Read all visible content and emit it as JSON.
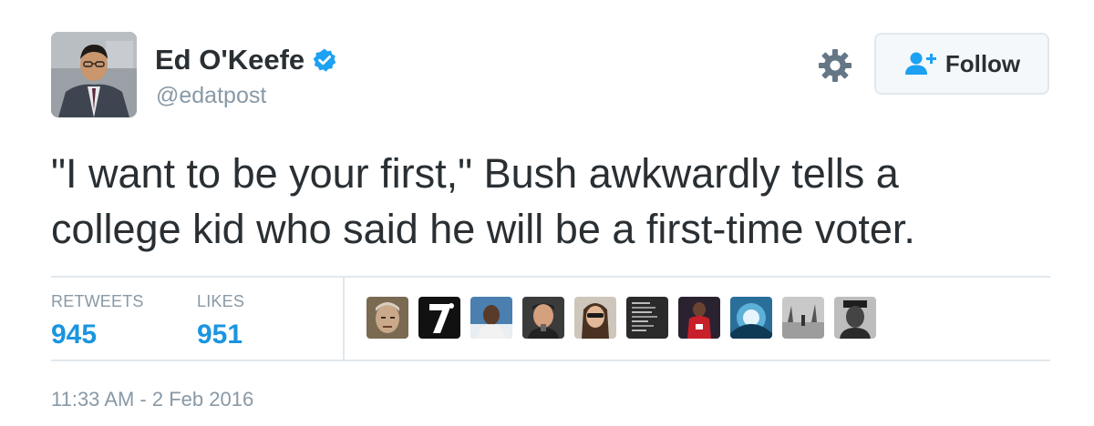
{
  "author": {
    "display_name": "Ed O'Keefe",
    "handle": "@edatpost",
    "verified": true,
    "avatar_icon": "profile-photo"
  },
  "header_actions": {
    "settings_icon": "gear-icon",
    "follow_label": "Follow",
    "follow_icon": "add-user-icon"
  },
  "tweet": {
    "text": "\"I want to be your first,\" Bush awkwardly tells a\ncollege kid who said he will be a first-time voter."
  },
  "stats": {
    "retweets_label": "RETWEETS",
    "retweets_count": "945",
    "likes_label": "LIKES",
    "likes_count": "951"
  },
  "likers": [
    {
      "icon": "face-avatar-1",
      "bg": "#7a6a52"
    },
    {
      "icon": "number-seven-avatar",
      "bg": "#111111"
    },
    {
      "icon": "face-avatar-3",
      "bg": "#4a7fb0"
    },
    {
      "icon": "face-avatar-4",
      "bg": "#3b3b3b"
    },
    {
      "icon": "face-avatar-5",
      "bg": "#cfc6bb"
    },
    {
      "icon": "text-avatar-6",
      "bg": "#2a2a2a"
    },
    {
      "icon": "basketball-avatar-7",
      "bg": "#2b2230"
    },
    {
      "icon": "abstract-avatar-8",
      "bg": "#2a6f9a"
    },
    {
      "icon": "beach-avatar-9",
      "bg": "#c9c9c9"
    },
    {
      "icon": "face-avatar-10",
      "bg": "#bdbdbd"
    }
  ],
  "timestamp": "11:33 AM - 2 Feb 2016",
  "colors": {
    "accent": "#1b95e0",
    "verified": "#1da1f2",
    "muted": "#8899a6",
    "text": "#292f33",
    "border": "#e1e8ed"
  }
}
